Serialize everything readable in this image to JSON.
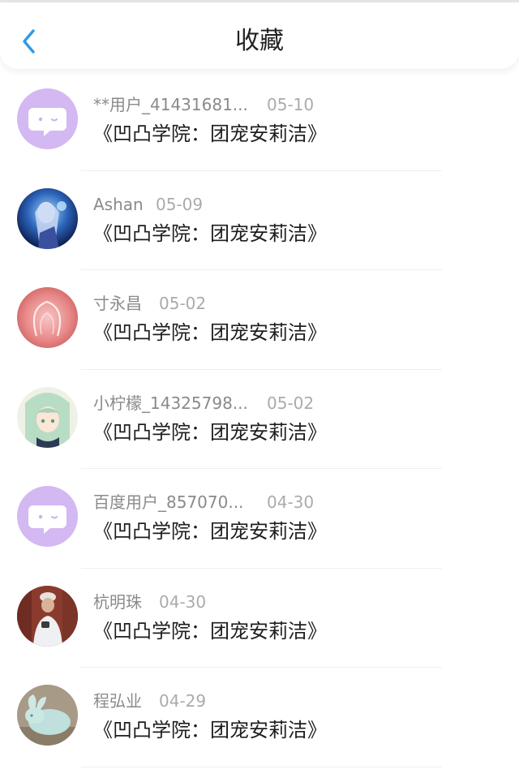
{
  "header": {
    "title": "收藏",
    "back_icon": "chevron-left-icon",
    "accent_color": "#2f9ae6"
  },
  "items": [
    {
      "name": "**用户_41431681...",
      "date": "05-10",
      "title": "《凹凸学院：团宠安莉洁》",
      "avatar": "default-chat-avatar"
    },
    {
      "name": "Ashan",
      "date": "05-09",
      "title": "《凹凸学院：团宠安莉洁》",
      "avatar": "anime-girl-blue-avatar"
    },
    {
      "name": "寸永昌",
      "date": "05-02",
      "title": "《凹凸学院：团宠安莉洁》",
      "avatar": "pink-glow-avatar"
    },
    {
      "name": "小柠檬_14325798...",
      "date": "05-02",
      "title": "《凹凸学院：团宠安莉洁》",
      "avatar": "anime-girl-green-avatar"
    },
    {
      "name": "百度用户_857070...",
      "date": "04-30",
      "title": "《凹凸学院：团宠安莉洁》",
      "avatar": "default-chat-avatar"
    },
    {
      "name": "杭明珠",
      "date": "04-30",
      "title": "《凹凸学院：团宠安莉洁》",
      "avatar": "person-photo-avatar"
    },
    {
      "name": "程弘业",
      "date": "04-29",
      "title": "《凹凸学院：团宠安莉洁》",
      "avatar": "jade-rabbit-avatar"
    }
  ]
}
